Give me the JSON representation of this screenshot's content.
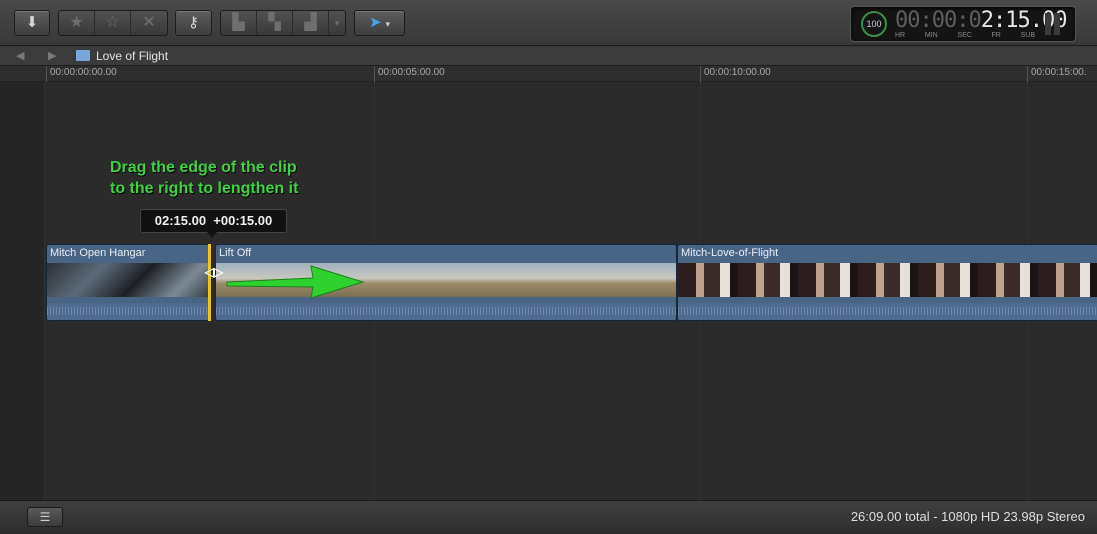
{
  "toolbar": {
    "import_icon": "download-arrow-icon",
    "rating_icons": [
      "favorite-star-icon",
      "unrate-star-icon",
      "reject-x-icon"
    ],
    "keyword_icon": "key-icon",
    "edit_icons": [
      "connect-clip-icon",
      "insert-clip-icon",
      "append-clip-icon"
    ],
    "select_tool_icon": "arrow-pointer-icon"
  },
  "timecode": {
    "percent": "100",
    "percent_unit": "%",
    "dim_digits": "00:00:0",
    "digits": "2:15.00",
    "labels": [
      "HR",
      "MIN",
      "SEC",
      "FR",
      "SUB"
    ]
  },
  "navigation": {
    "back_icon": "back-arrow-icon",
    "forward_icon": "forward-arrow-icon",
    "project_title": "Love of Flight"
  },
  "ruler": {
    "ticks": [
      "00:00:00:00.00",
      "00:00:05:00.00",
      "00:00:10:00.00",
      "00:00:15:00."
    ]
  },
  "annotation": {
    "line1": "Drag the edge of the clip",
    "line2": "to the right to lengthen it"
  },
  "tooltip": {
    "text": "02:15.00  +00:15.00"
  },
  "clips": [
    {
      "name": "Mitch Open Hangar"
    },
    {
      "name": "Lift Off"
    },
    {
      "name": "Mitch-Love-of-Flight"
    }
  ],
  "status": {
    "summary": "26:09.00 total - 1080p HD 23.98p Stereo"
  },
  "colors": {
    "annotation": "#3ed33e",
    "clip": "#4a6486",
    "selection": "#f0c419"
  }
}
